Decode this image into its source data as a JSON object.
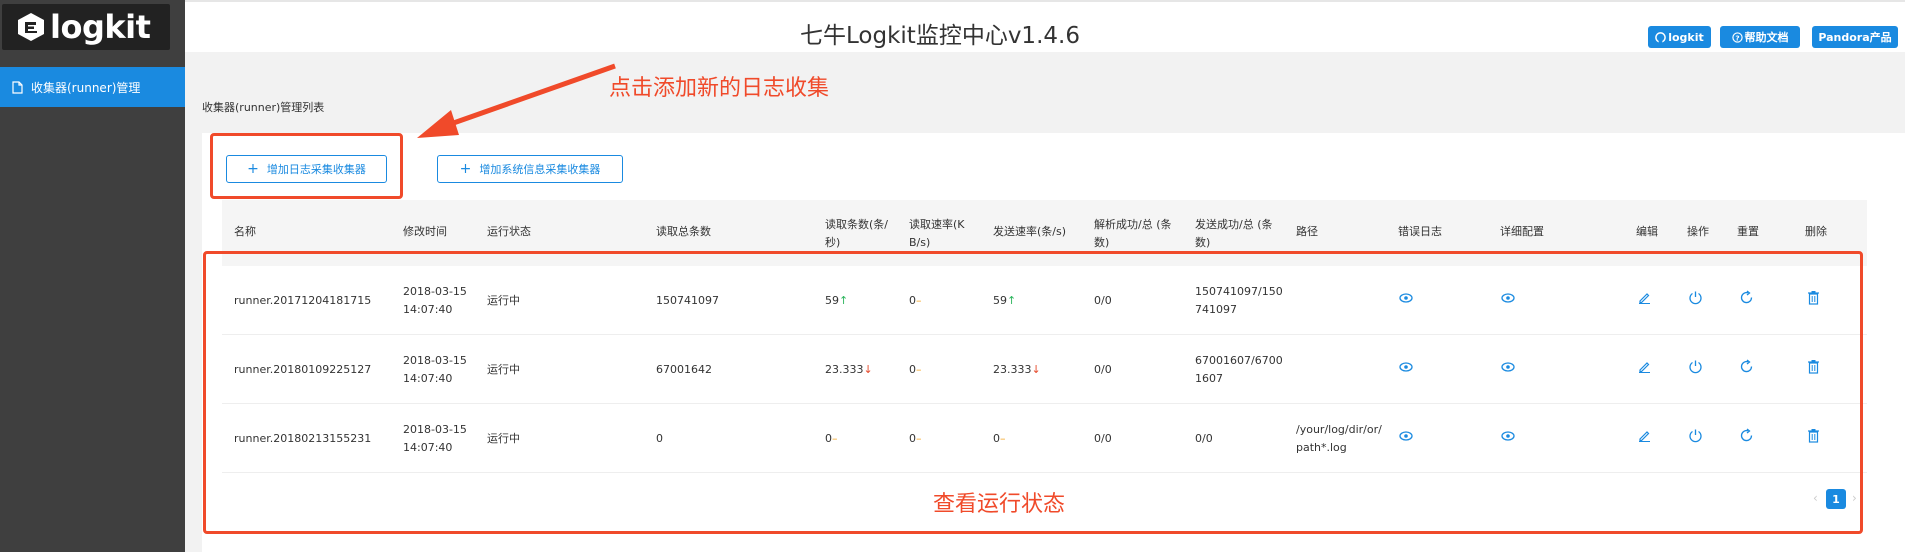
{
  "brand": {
    "logo_text": "logkit"
  },
  "header": {
    "title": "七牛Logkit监控中心v1.4.6",
    "btn_logkit": "logkit",
    "btn_help": "帮助文档",
    "btn_pandora": "Pandora产品"
  },
  "sidebar": {
    "item": "收集器(runner)管理"
  },
  "breadcrumb": "收集器(runner)管理列表",
  "actions": {
    "add_log": "增加日志采集收集器",
    "add_system": "增加系统信息采集收集器"
  },
  "table": {
    "headers": {
      "name": "名称",
      "mtime": "修改时间",
      "status": "运行状态",
      "read_total": "读取总条数",
      "read_count_a": "读取条数(条/",
      "read_count_b": "秒)",
      "read_rate_a": "读取速率(K",
      "read_rate_b": "B/s)",
      "send_rate": "发送速率(条/s)",
      "parse_a": "解析成功/总 (条",
      "parse_b": "数)",
      "send_a": "发送成功/总 (条",
      "send_b": "数)",
      "path": "路径",
      "error_log": "错误日志",
      "detail": "详细配置",
      "edit": "编辑",
      "operate": "操作",
      "reset": "重置",
      "delete": "删除"
    },
    "rows": [
      {
        "name": "runner.20171204181715",
        "date": "2018-03-15",
        "time": "14:07:40",
        "status": "运行中",
        "read_total": "150741097",
        "read_count": "59",
        "read_count_trend": "↑",
        "read_rate": "0",
        "read_rate_trend": "–",
        "send_rate": "59",
        "send_rate_trend": "↑",
        "parse": "0/0",
        "send_a": "150741097/150",
        "send_b": "741097",
        "path_a": "",
        "path_b": ""
      },
      {
        "name": "runner.20180109225127",
        "date": "2018-03-15",
        "time": "14:07:40",
        "status": "运行中",
        "read_total": "67001642",
        "read_count": "23.333",
        "read_count_trend": "↓",
        "read_rate": "0",
        "read_rate_trend": "–",
        "send_rate": "23.333",
        "send_rate_trend": "↓",
        "parse": "0/0",
        "send_a": "67001607/6700",
        "send_b": "1607",
        "path_a": "",
        "path_b": ""
      },
      {
        "name": "runner.20180213155231",
        "date": "2018-03-15",
        "time": "14:07:40",
        "status": "运行中",
        "read_total": "0",
        "read_count": "0",
        "read_count_trend": "–",
        "read_rate": "0",
        "read_rate_trend": "–",
        "send_rate": "0",
        "send_rate_trend": "–",
        "parse": "0/0",
        "send_a": "0/0",
        "send_b": "",
        "path_a": "/your/log/dir/or/",
        "path_b": "path*.log"
      }
    ]
  },
  "pagination": {
    "prev": "‹",
    "current": "1",
    "next": "›"
  },
  "annotations": {
    "add_note": "点击添加新的日志收集",
    "status_note": "查看运行状态"
  },
  "colors": {
    "accent": "#1a8ae0",
    "annotation": "#f04a2a",
    "sidebar": "#3f3f3f"
  }
}
